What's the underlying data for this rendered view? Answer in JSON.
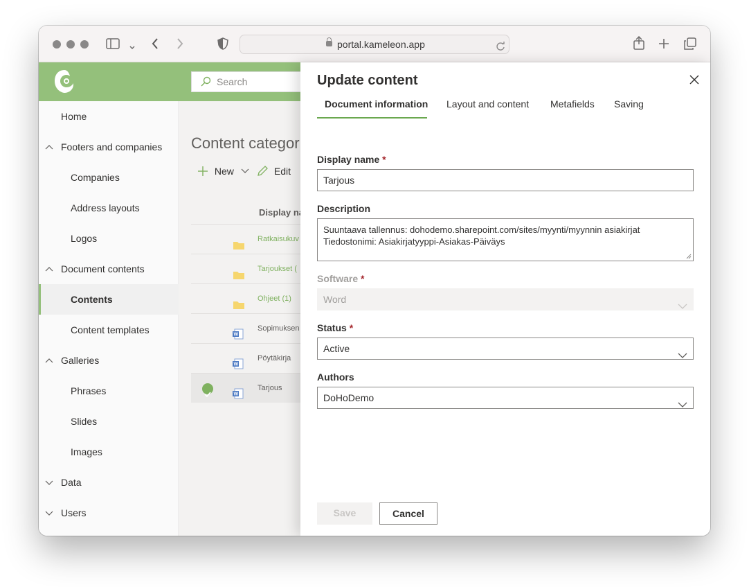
{
  "browser": {
    "url": "portal.kameleon.app",
    "icons": [
      "sidebar-icon",
      "chevron-down-icon",
      "back-icon",
      "forward-icon",
      "shield-icon",
      "lock-icon",
      "reload-icon",
      "share-icon",
      "new-tab-icon",
      "tabs-icon"
    ]
  },
  "app": {
    "search_placeholder": "Search"
  },
  "nav": {
    "items": [
      {
        "label": "Home",
        "level": "top"
      },
      {
        "label": "Footers and companies",
        "level": "group",
        "expanded": true
      },
      {
        "label": "Companies",
        "level": "sub"
      },
      {
        "label": "Address layouts",
        "level": "sub"
      },
      {
        "label": "Logos",
        "level": "sub"
      },
      {
        "label": "Document contents",
        "level": "group",
        "expanded": true
      },
      {
        "label": "Contents",
        "level": "sub",
        "active": true
      },
      {
        "label": "Content templates",
        "level": "sub"
      },
      {
        "label": "Galleries",
        "level": "group",
        "expanded": true
      },
      {
        "label": "Phrases",
        "level": "sub"
      },
      {
        "label": "Slides",
        "level": "sub"
      },
      {
        "label": "Images",
        "level": "sub"
      },
      {
        "label": "Data",
        "level": "group",
        "expanded": false
      },
      {
        "label": "Users",
        "level": "group",
        "expanded": false
      }
    ]
  },
  "content": {
    "title": "Content categor",
    "new_label": "New",
    "edit_label": "Edit",
    "column_display_name": "Display na",
    "rows": [
      {
        "name": "Ratkaisukuv",
        "type": "folder"
      },
      {
        "name": "Tarjoukset (",
        "type": "folder"
      },
      {
        "name": "Ohjeet (1)",
        "type": "folder"
      },
      {
        "name": "Sopimuksen",
        "type": "word"
      },
      {
        "name": "Pöytäkirja",
        "type": "word"
      },
      {
        "name": "Tarjous",
        "type": "word",
        "selected": true
      }
    ]
  },
  "panel": {
    "title": "Update content",
    "tabs": [
      "Document information",
      "Layout and content",
      "Metafields",
      "Saving"
    ],
    "active_tab": "Document information",
    "display_name_label": "Display name",
    "display_name_value": "Tarjous",
    "description_label": "Description",
    "description_line1": "Suuntaava tallennus: dohodemo.sharepoint.com/sites/myynti/myynnin asiakirjat",
    "description_line2": "Tiedostonimi: Asiakirjatyyppi-Asiakas-Päiväys",
    "software_label": "Software",
    "software_value": "Word",
    "status_label": "Status",
    "status_value": "Active",
    "authors_label": "Authors",
    "authors_value": "DoHoDemo",
    "required_mark": "*",
    "save_label": "Save",
    "cancel_label": "Cancel"
  },
  "colors": {
    "brand_green": "#94c07b",
    "accent_green": "#6aa84f",
    "required_red": "#a4262c"
  }
}
